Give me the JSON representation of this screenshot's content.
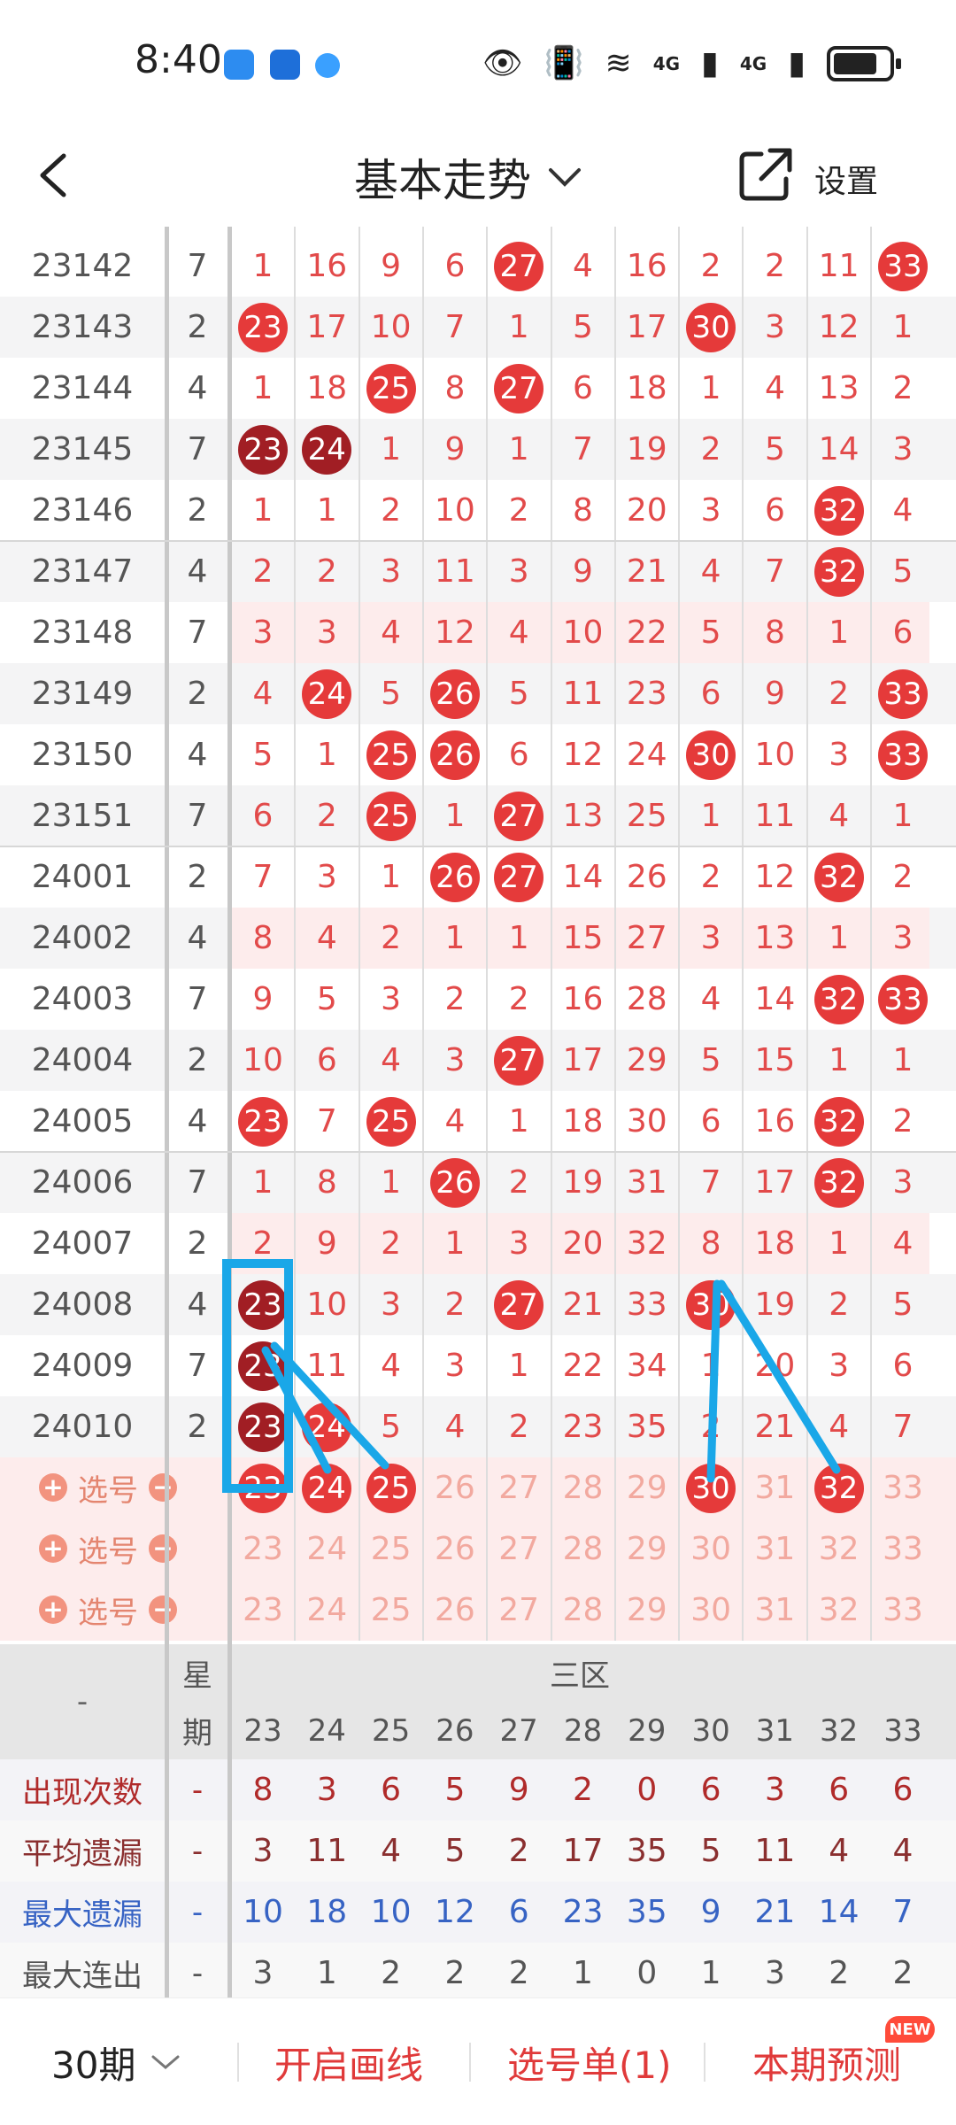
{
  "status_bar": {
    "time": "8:40",
    "signal1_label": "4G",
    "signal2_label": "4G"
  },
  "header": {
    "title": "基本走势",
    "settings_label": "设置"
  },
  "numbers": [
    23,
    24,
    25,
    26,
    27,
    28,
    29,
    30,
    31,
    32,
    33
  ],
  "rows": [
    {
      "issue": "23142",
      "wk": "7",
      "vals": [
        1,
        16,
        9,
        6,
        27,
        4,
        16,
        2,
        2,
        11,
        33
      ],
      "hits": [
        4,
        10
      ],
      "dark": [],
      "pink": false
    },
    {
      "issue": "23143",
      "wk": "2",
      "vals": [
        23,
        17,
        10,
        7,
        1,
        5,
        17,
        30,
        3,
        12,
        1
      ],
      "hits": [
        0,
        7
      ],
      "dark": [],
      "pink": false
    },
    {
      "issue": "23144",
      "wk": "4",
      "vals": [
        1,
        18,
        25,
        8,
        27,
        6,
        18,
        1,
        4,
        13,
        2
      ],
      "hits": [
        2,
        4
      ],
      "dark": [],
      "pink": false
    },
    {
      "issue": "23145",
      "wk": "7",
      "vals": [
        23,
        24,
        1,
        9,
        1,
        7,
        19,
        2,
        5,
        14,
        3
      ],
      "hits": [
        0,
        1
      ],
      "dark": [
        0,
        1
      ],
      "pink": false
    },
    {
      "issue": "23146",
      "wk": "2",
      "vals": [
        1,
        1,
        2,
        10,
        2,
        8,
        20,
        3,
        6,
        32,
        4
      ],
      "hits": [
        9
      ],
      "dark": [],
      "pink": false
    },
    {
      "issue": "23147",
      "wk": "4",
      "vals": [
        2,
        2,
        3,
        11,
        3,
        9,
        21,
        4,
        7,
        32,
        5
      ],
      "hits": [
        9
      ],
      "dark": [],
      "pink": false
    },
    {
      "issue": "23148",
      "wk": "7",
      "vals": [
        3,
        3,
        4,
        12,
        4,
        10,
        22,
        5,
        8,
        1,
        6
      ],
      "hits": [],
      "dark": [],
      "pink": true
    },
    {
      "issue": "23149",
      "wk": "2",
      "vals": [
        4,
        24,
        5,
        26,
        5,
        11,
        23,
        6,
        9,
        2,
        33
      ],
      "hits": [
        1,
        3,
        10
      ],
      "dark": [],
      "pink": false
    },
    {
      "issue": "23150",
      "wk": "4",
      "vals": [
        5,
        1,
        25,
        26,
        6,
        12,
        24,
        30,
        10,
        3,
        33
      ],
      "hits": [
        2,
        3,
        7,
        10
      ],
      "dark": [],
      "pink": false
    },
    {
      "issue": "23151",
      "wk": "7",
      "vals": [
        6,
        2,
        25,
        1,
        27,
        13,
        25,
        1,
        11,
        4,
        1
      ],
      "hits": [
        2,
        4
      ],
      "dark": [],
      "pink": false
    },
    {
      "issue": "24001",
      "wk": "2",
      "vals": [
        7,
        3,
        1,
        26,
        27,
        14,
        26,
        2,
        12,
        32,
        2
      ],
      "hits": [
        3,
        4,
        9
      ],
      "dark": [],
      "pink": false
    },
    {
      "issue": "24002",
      "wk": "4",
      "vals": [
        8,
        4,
        2,
        1,
        1,
        15,
        27,
        3,
        13,
        1,
        3
      ],
      "hits": [],
      "dark": [],
      "pink": true
    },
    {
      "issue": "24003",
      "wk": "7",
      "vals": [
        9,
        5,
        3,
        2,
        2,
        16,
        28,
        4,
        14,
        32,
        33
      ],
      "hits": [
        9,
        10
      ],
      "dark": [],
      "pink": false
    },
    {
      "issue": "24004",
      "wk": "2",
      "vals": [
        10,
        6,
        4,
        3,
        27,
        17,
        29,
        5,
        15,
        1,
        1
      ],
      "hits": [
        4
      ],
      "dark": [],
      "pink": false
    },
    {
      "issue": "24005",
      "wk": "4",
      "vals": [
        23,
        7,
        25,
        4,
        1,
        18,
        30,
        6,
        16,
        32,
        2
      ],
      "hits": [
        0,
        2,
        9
      ],
      "dark": [],
      "pink": false
    },
    {
      "issue": "24006",
      "wk": "7",
      "vals": [
        1,
        8,
        1,
        26,
        2,
        19,
        31,
        7,
        17,
        32,
        3
      ],
      "hits": [
        3,
        9
      ],
      "dark": [],
      "pink": false
    },
    {
      "issue": "24007",
      "wk": "2",
      "vals": [
        2,
        9,
        2,
        1,
        3,
        20,
        32,
        8,
        18,
        1,
        4
      ],
      "hits": [],
      "dark": [],
      "pink": true
    },
    {
      "issue": "24008",
      "wk": "4",
      "vals": [
        23,
        10,
        3,
        2,
        27,
        21,
        33,
        30,
        19,
        2,
        5
      ],
      "hits": [
        0,
        4,
        7
      ],
      "dark": [
        0
      ],
      "pink": false
    },
    {
      "issue": "24009",
      "wk": "7",
      "vals": [
        23,
        11,
        4,
        3,
        1,
        22,
        34,
        1,
        20,
        3,
        6
      ],
      "hits": [
        0
      ],
      "dark": [
        0
      ],
      "pink": false
    },
    {
      "issue": "24010",
      "wk": "2",
      "vals": [
        23,
        24,
        5,
        4,
        2,
        23,
        35,
        2,
        21,
        4,
        7
      ],
      "hits": [
        0,
        1
      ],
      "dark": [
        0
      ],
      "pink": false
    }
  ],
  "picker": {
    "label": "选号",
    "selected": [
      0,
      1,
      2,
      7,
      9
    ]
  },
  "stats_header": {
    "dash": "-",
    "weekday_top": "星",
    "weekday_bottom": "期",
    "zone": "三区"
  },
  "stats": [
    {
      "label": "出现次数",
      "dash": "-",
      "values": [
        8,
        3,
        6,
        5,
        9,
        2,
        0,
        6,
        3,
        6,
        6
      ],
      "color": "#b02a2a"
    },
    {
      "label": "平均遗漏",
      "dash": "-",
      "values": [
        3,
        11,
        4,
        5,
        2,
        17,
        35,
        5,
        11,
        4,
        4
      ],
      "color": "#8a2f2f"
    },
    {
      "label": "最大遗漏",
      "dash": "-",
      "values": [
        10,
        18,
        10,
        12,
        6,
        23,
        35,
        9,
        21,
        14,
        7
      ],
      "color": "#3763c4"
    },
    {
      "label": "最大连出",
      "dash": "-",
      "values": [
        3,
        1,
        2,
        2,
        2,
        1,
        0,
        1,
        3,
        2,
        2
      ],
      "color": "#555555"
    }
  ],
  "bottom_bar": {
    "period": "30期",
    "draw_line": "开启画线",
    "pick_list": "选号单(1)",
    "predict": "本期预测",
    "new_badge": "NEW"
  },
  "colors": {
    "hit": "#e53a3a",
    "hit_dark": "#a11e24",
    "annotation": "#1aa7e8",
    "accent": "#e03a3a"
  }
}
